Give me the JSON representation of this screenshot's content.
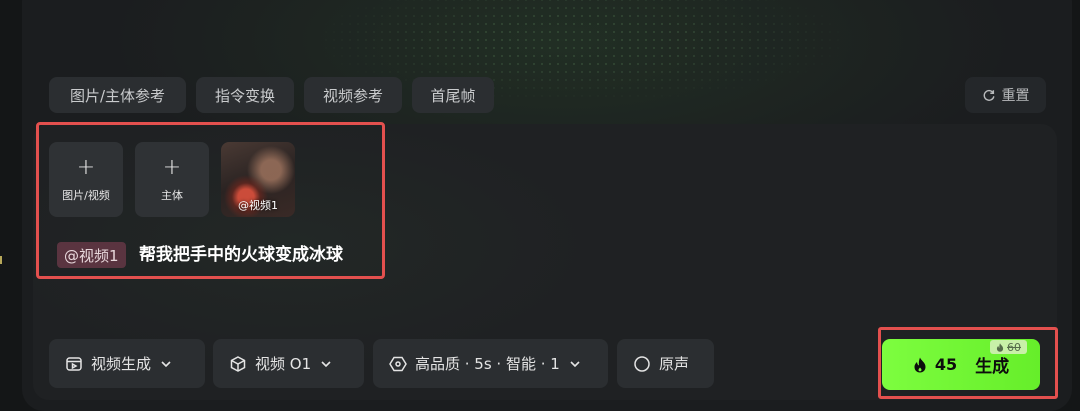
{
  "tabs": [
    {
      "label": "图片/主体参考"
    },
    {
      "label": "指令变换"
    },
    {
      "label": "视频参考"
    },
    {
      "label": "首尾帧"
    }
  ],
  "reset": {
    "label": "重置",
    "icon": "refresh-icon"
  },
  "uploads": {
    "image_video": {
      "label": "图片/视频",
      "icon": "plus-icon"
    },
    "subject": {
      "label": "主体",
      "icon": "plus-icon"
    },
    "video_thumb": {
      "caption": "@视频1"
    }
  },
  "prompt": {
    "mention": "@视频1",
    "text": "帮我把手中的火球变成冰球"
  },
  "controls": {
    "mode": {
      "label": "视频生成",
      "icon": "video-icon"
    },
    "model": {
      "label": "视频 O1",
      "icon": "cube-icon"
    },
    "settings": {
      "label": "高品质 · 5s · 智能 · 1",
      "icon": "hexagon-icon"
    },
    "audio": {
      "label": "原声",
      "icon": "radio-icon"
    }
  },
  "generate": {
    "label": "生成",
    "cost": "45",
    "original_cost": "60",
    "icon": "flame-icon",
    "accent": "#7dfd3f"
  },
  "colors": {
    "highlight_border": "#e3504e",
    "mention_bg": "#5a3440"
  }
}
